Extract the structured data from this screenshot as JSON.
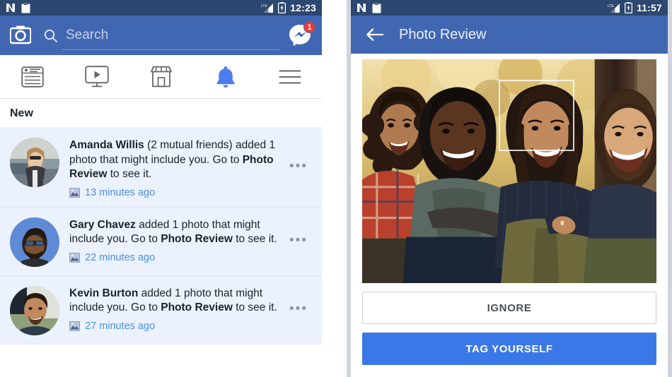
{
  "left_phone": {
    "status_bar": {
      "time": "12:23",
      "icons": [
        "netflix-n-icon",
        "clipboard-icon",
        "signal-bars-icon",
        "battery-charging-icon"
      ]
    },
    "header": {
      "camera_icon": "camera-icon",
      "search": {
        "value": "",
        "placeholder": "Search"
      },
      "messenger_icon": "messenger-icon",
      "messenger_badge": "1"
    },
    "tabs": [
      {
        "name": "news-feed",
        "icon": "news-feed-icon",
        "active": false
      },
      {
        "name": "watch",
        "icon": "video-monitor-icon",
        "active": false
      },
      {
        "name": "marketplace",
        "icon": "storefront-icon",
        "active": false
      },
      {
        "name": "notifications",
        "icon": "bell-icon",
        "active": true
      },
      {
        "name": "menu",
        "icon": "hamburger-menu-icon",
        "active": false
      }
    ],
    "section_title": "New",
    "notifications": [
      {
        "name_text": "Amanda Willis",
        "mutual_text": " (2 mutual friends)",
        "body_before": " added 1 photo that might include you. Go to ",
        "link_text": "Photo Review",
        "body_after": " to see it.",
        "time": "13 minutes ago",
        "meta_icon": "photo-thumbnail-icon",
        "more_icon": "•••",
        "unread": true
      },
      {
        "name_text": "Gary Chavez",
        "mutual_text": "",
        "body_before": " added 1 photo that might include you. Go to ",
        "link_text": "Photo Review",
        "body_after": " to see it.",
        "time": "22 minutes ago",
        "meta_icon": "photo-thumbnail-icon",
        "more_icon": "•••",
        "unread": true
      },
      {
        "name_text": "Kevin Burton",
        "mutual_text": "",
        "body_before": " added 1 photo that might include you. Go to ",
        "link_text": "Photo Review",
        "body_after": " to see it.",
        "time": "27 minutes ago",
        "meta_icon": "photo-thumbnail-icon",
        "more_icon": "•••",
        "unread": true
      }
    ]
  },
  "right_phone": {
    "status_bar": {
      "time": "11:57",
      "icons": [
        "netflix-n-icon",
        "clipboard-icon",
        "signal-bars-icon",
        "battery-charging-icon"
      ]
    },
    "header": {
      "back_icon": "back-arrow-icon",
      "title": "Photo Review"
    },
    "photo": {
      "description": "group-photo-four-friends-outdoors",
      "face_tag_box": "face-tag-rectangle"
    },
    "buttons": {
      "ignore": "IGNORE",
      "tag_yourself": "TAG YOURSELF"
    }
  },
  "colors": {
    "status_bar": "#2c4770",
    "header_blue": "#4267b2",
    "unread_row": "#ebf2fe",
    "link_blue": "#4a90e2",
    "badge_red": "#ec3b33",
    "primary_button": "#3b78e7",
    "bell_active": "#4a7ef0",
    "text_dark": "#1d2129"
  }
}
